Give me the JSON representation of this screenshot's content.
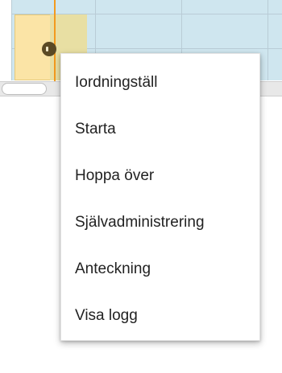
{
  "calendar": {
    "background_color": "#cfe6ef",
    "appointment_color": "#fbe4a6",
    "time_marker_color": "#f39a1e",
    "handle_icon": "drag-handle-icon"
  },
  "context_menu": {
    "items": [
      {
        "label": "Iordningställ"
      },
      {
        "label": "Starta"
      },
      {
        "label": "Hoppa över"
      },
      {
        "label": "Självadministrering"
      },
      {
        "label": "Anteckning"
      },
      {
        "label": "Visa logg"
      }
    ]
  }
}
